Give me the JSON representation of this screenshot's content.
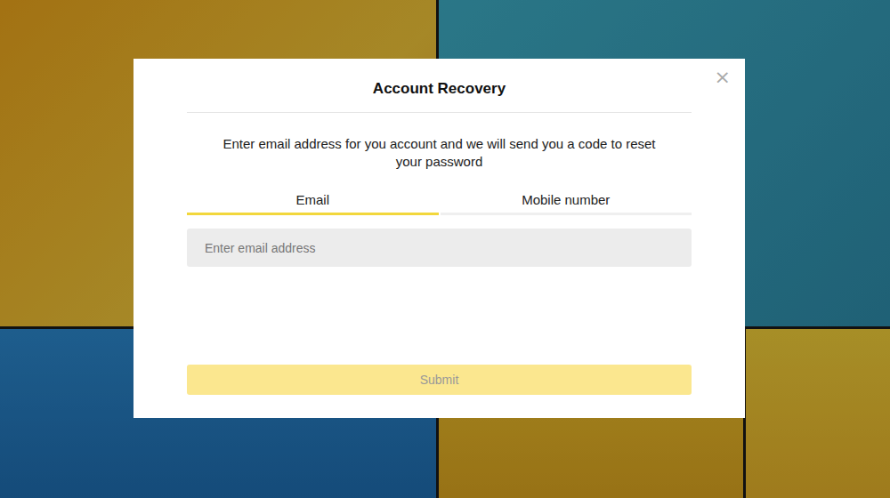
{
  "dialog": {
    "title": "Account Recovery",
    "close": "×",
    "description": "Enter email address for you account and we will send you a code to reset your password"
  },
  "tabs": [
    {
      "label": "Email",
      "selected": true
    },
    {
      "label": "Mobile number",
      "selected": false
    }
  ],
  "input": {
    "placeholder": "Enter email address",
    "value": ""
  },
  "submit": {
    "label": "Submit",
    "disabled": true
  }
}
